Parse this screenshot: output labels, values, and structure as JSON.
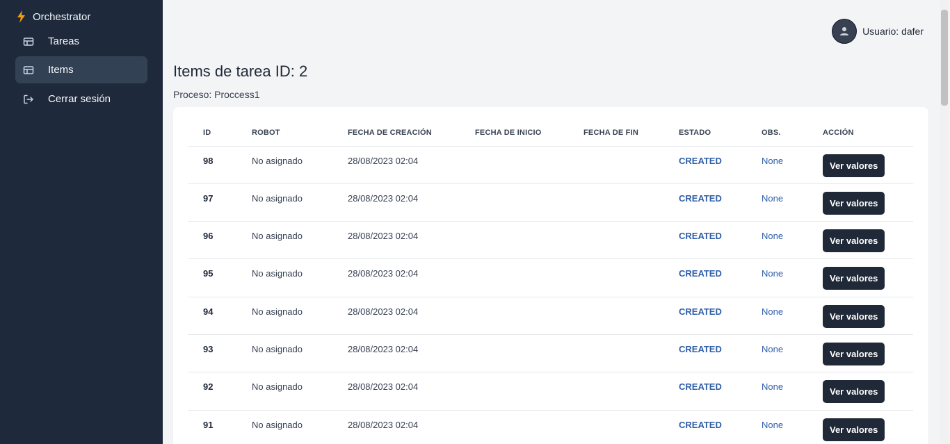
{
  "app": {
    "title": "Orchestrator"
  },
  "sidebar": {
    "items": [
      {
        "label": "Tareas",
        "icon": "table-icon"
      },
      {
        "label": "Items",
        "icon": "table-icon",
        "active": true
      },
      {
        "label": "Cerrar sesión",
        "icon": "logout-icon"
      }
    ]
  },
  "user": {
    "label": "Usuario: dafer"
  },
  "page": {
    "title": "Items de tarea ID: 2",
    "subtitle": "Proceso: Proccess1"
  },
  "table": {
    "headers": [
      "ID",
      "ROBOT",
      "FECHA DE CREACIÓN",
      "FECHA DE INICIO",
      "FECHA DE FIN",
      "ESTADO",
      "OBS.",
      "ACCIÓN"
    ],
    "rows": [
      {
        "id": "98",
        "robot": "No asignado",
        "created": "28/08/2023 02:04",
        "start": "",
        "end": "",
        "status": "CREATED",
        "obs": "None",
        "action": "Ver valores"
      },
      {
        "id": "97",
        "robot": "No asignado",
        "created": "28/08/2023 02:04",
        "start": "",
        "end": "",
        "status": "CREATED",
        "obs": "None",
        "action": "Ver valores"
      },
      {
        "id": "96",
        "robot": "No asignado",
        "created": "28/08/2023 02:04",
        "start": "",
        "end": "",
        "status": "CREATED",
        "obs": "None",
        "action": "Ver valores"
      },
      {
        "id": "95",
        "robot": "No asignado",
        "created": "28/08/2023 02:04",
        "start": "",
        "end": "",
        "status": "CREATED",
        "obs": "None",
        "action": "Ver valores"
      },
      {
        "id": "94",
        "robot": "No asignado",
        "created": "28/08/2023 02:04",
        "start": "",
        "end": "",
        "status": "CREATED",
        "obs": "None",
        "action": "Ver valores"
      },
      {
        "id": "93",
        "robot": "No asignado",
        "created": "28/08/2023 02:04",
        "start": "",
        "end": "",
        "status": "CREATED",
        "obs": "None",
        "action": "Ver valores"
      },
      {
        "id": "92",
        "robot": "No asignado",
        "created": "28/08/2023 02:04",
        "start": "",
        "end": "",
        "status": "CREATED",
        "obs": "None",
        "action": "Ver valores"
      },
      {
        "id": "91",
        "robot": "No asignado",
        "created": "28/08/2023 02:04",
        "start": "",
        "end": "",
        "status": "CREATED",
        "obs": "None",
        "action": "Ver valores"
      }
    ]
  },
  "colors": {
    "sidebar_bg": "#1e293b",
    "sidebar_active": "#334155",
    "status_text": "#2f5ea8",
    "button_bg": "#1f2937"
  }
}
